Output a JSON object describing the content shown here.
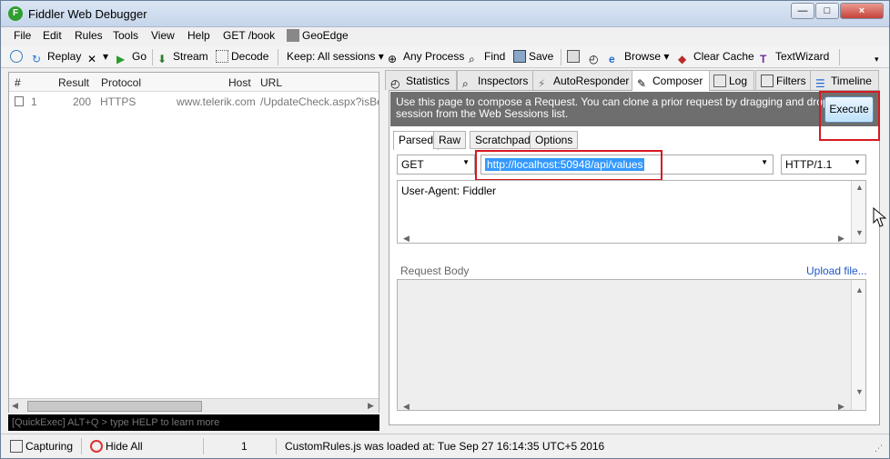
{
  "window": {
    "title": "Fiddler Web Debugger"
  },
  "menu": {
    "items": [
      "File",
      "Edit",
      "Rules",
      "Tools",
      "View",
      "Help",
      "GET /book",
      "GeoEdge"
    ]
  },
  "toolbar": {
    "replay": "Replay",
    "go": "Go",
    "stream": "Stream",
    "decode": "Decode",
    "keep": "Keep: All sessions",
    "process": "Any Process",
    "find": "Find",
    "save": "Save",
    "browse": "Browse",
    "clear_cache": "Clear Cache",
    "textwizard": "TextWizard"
  },
  "sessions": {
    "headers": {
      "num": "#",
      "result": "Result",
      "protocol": "Protocol",
      "host": "Host",
      "url": "URL"
    },
    "rows": [
      {
        "num": "1",
        "result": "200",
        "protocol": "HTTPS",
        "host": "www.telerik.com",
        "url": "/UpdateCheck.aspx?isBet..."
      }
    ]
  },
  "quickexec": {
    "placeholder": "[QuickExec] ALT+Q > type HELP to learn more"
  },
  "tabs": [
    "Statistics",
    "Inspectors",
    "AutoResponder",
    "Composer",
    "Log",
    "Filters",
    "Timeline"
  ],
  "composer": {
    "info": "Use this page to compose a Request. You can clone a prior request by dragging and dropping a session from the Web Sessions list.",
    "execute": "Execute",
    "subtabs": [
      "Parsed",
      "Raw",
      "Scratchpad",
      "Options"
    ],
    "method": "GET",
    "url": "http://localhost:50948/api/values",
    "version": "HTTP/1.1",
    "headers_text": "User-Agent: Fiddler",
    "request_body_label": "Request Body",
    "upload_file": "Upload file..."
  },
  "status": {
    "capturing": "Capturing",
    "hide_all": "Hide All",
    "count": "1",
    "message": "CustomRules.js was loaded at: Tue Sep 27 16:14:35 UTC+5 2016"
  },
  "colors": {
    "highlight": "#d71920",
    "selection": "#3399ff",
    "info_bg": "#6e6e6e",
    "link": "#1c57c9"
  }
}
